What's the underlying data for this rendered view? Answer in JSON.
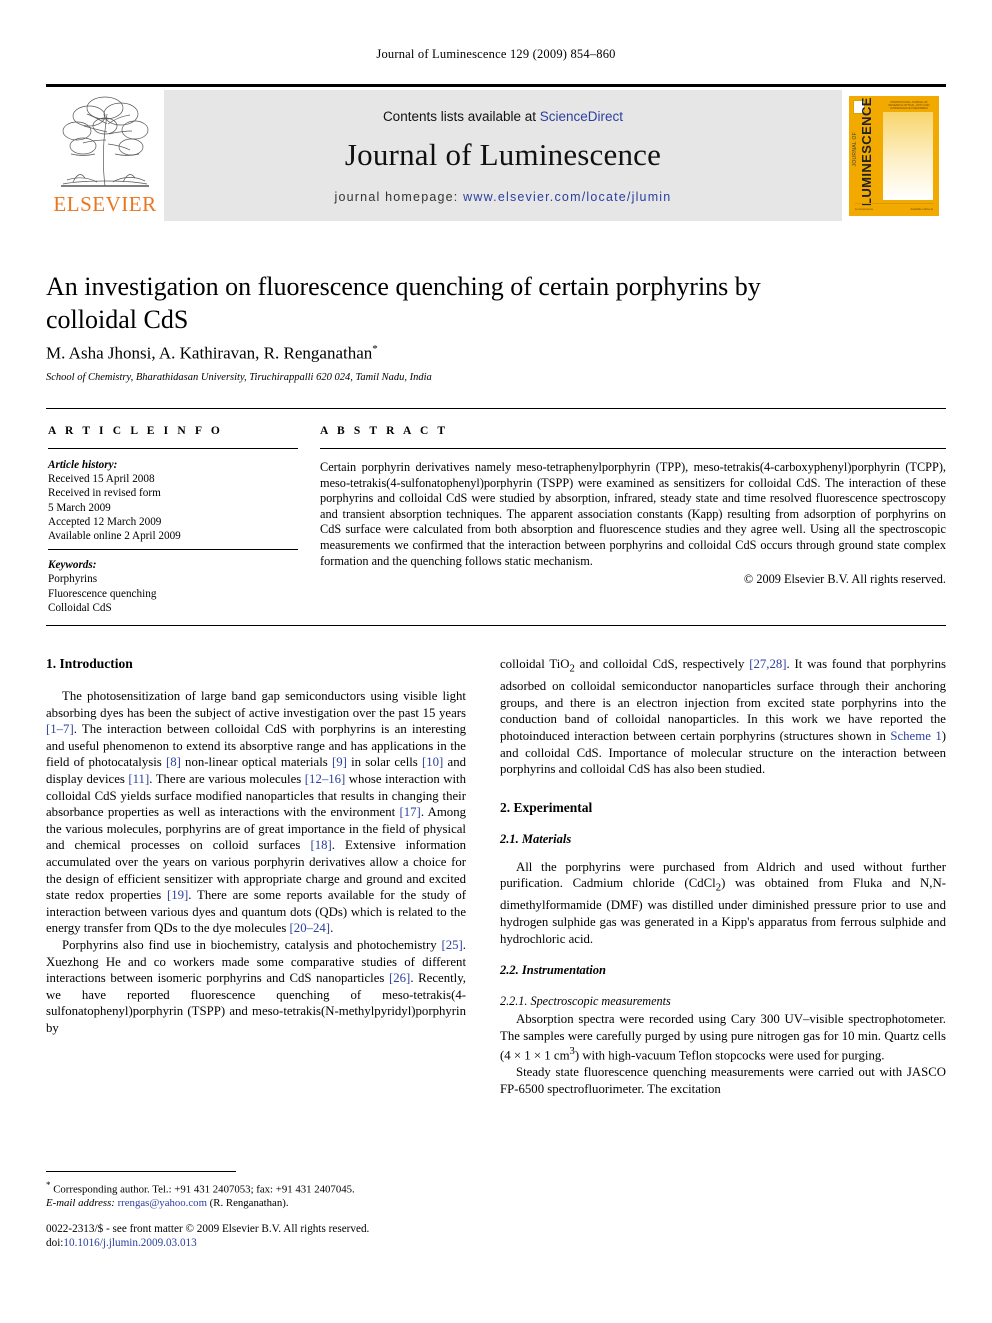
{
  "running_head": "Journal of Luminescence 129 (2009) 854–860",
  "masthead": {
    "elsevier_wordmark": "ELSEVIER",
    "contents_prefix": "Contents lists available at ",
    "sciencedirect": "ScienceDirect",
    "journal_title": "Journal of Luminescence",
    "homepage_prefix": "journal homepage: ",
    "homepage_url": "www.elsevier.com/locate/jlumin",
    "cover": {
      "vertical_main": "LUMINESCENCE",
      "vertical_small": "JOURNAL OF",
      "top_caption": "INTERNATIONAL JOURNAL OF RESEARCH OPTICAL, OPTO AND LUMINESCENCE PHENOMENA",
      "bottom_left": "Luminescence",
      "bottom_right": "Available online at"
    },
    "accent_orange": "#E87722",
    "cover_yellow": "#F2A900",
    "link_blue": "#2b3f9e",
    "banner_gray": "#e6e6e6"
  },
  "article": {
    "title": "An investigation on fluorescence quenching of certain porphyrins by colloidal CdS",
    "authors": "M. Asha Jhonsi, A. Kathiravan, R. Renganathan",
    "author_marker": "*",
    "affiliation": "School of Chemistry, Bharathidasan University, Tiruchirappalli 620 024, Tamil Nadu, India"
  },
  "article_info": {
    "heading": "A R T I C L E   I N F O",
    "history_label": "Article history:",
    "history": [
      "Received 15 April 2008",
      "Received in revised form",
      "5 March 2009",
      "Accepted 12 March 2009",
      "Available online 2 April 2009"
    ],
    "keywords_label": "Keywords:",
    "keywords": [
      "Porphyrins",
      "Fluorescence quenching",
      "Colloidal CdS"
    ]
  },
  "abstract": {
    "heading": "A B S T R A C T",
    "text": "Certain porphyrin derivatives namely meso-tetraphenylporphyrin (TPP), meso-tetrakis(4-carboxyphenyl)porphyrin (TCPP), meso-tetrakis(4-sulfonatophenyl)porphyrin (TSPP) were examined as sensitizers for colloidal CdS. The interaction of these porphyrins and colloidal CdS were studied by absorption, infrared, steady state and time resolved fluorescence spectroscopy and transient absorption techniques. The apparent association constants (Kapp) resulting from adsorption of porphyrins on CdS surface were calculated from both absorption and fluorescence studies and they agree well. Using all the spectroscopic measurements we confirmed that the interaction between porphyrins and colloidal CdS occurs through ground state complex formation and the quenching follows static mechanism.",
    "copyright": "© 2009 Elsevier B.V. All rights reserved."
  },
  "body": {
    "intro_heading": "1.  Introduction",
    "intro_p1_a": "The photosensitization of large band gap semiconductors using visible light absorbing dyes has been the subject of active investigation over the past 15 years ",
    "intro_p1_r1": "[1–7]",
    "intro_p1_b": ". The interaction between colloidal CdS with porphyrins is an interesting and useful phenomenon to extend its absorptive range and has applications in the field of photocatalysis ",
    "intro_p1_r2": "[8]",
    "intro_p1_c": " non-linear optical materials ",
    "intro_p1_r3": "[9]",
    "intro_p1_d": " in solar cells ",
    "intro_p1_r4": "[10]",
    "intro_p1_e": " and display devices ",
    "intro_p1_r5": "[11]",
    "intro_p1_f": ". There are various molecules ",
    "intro_p1_r6": "[12–16]",
    "intro_p1_g": " whose interaction with colloidal CdS yields surface modified nanoparticles that results in changing their absorbance properties as well as interactions with the environment ",
    "intro_p1_r7": "[17]",
    "intro_p1_h": ". Among the various molecules, porphyrins are of great importance in the field of physical and chemical processes on colloid surfaces ",
    "intro_p1_r8": "[18]",
    "intro_p1_i": ". Extensive information accumulated over the years on various porphyrin derivatives allow a choice for the design of efficient sensitizer with appropriate charge and ground and excited state redox properties ",
    "intro_p1_r9": "[19]",
    "intro_p1_j": ". There are some reports available for the study of interaction between various dyes and quantum dots (QDs) which is related to the energy transfer from QDs to the dye molecules ",
    "intro_p1_r10": "[20–24]",
    "intro_p1_k": ".",
    "intro_p2_a": "Porphyrins also find use in biochemistry, catalysis and photochemistry ",
    "intro_p2_r1": "[25]",
    "intro_p2_b": ". Xuezhong He and co workers made some comparative studies of different interactions between isomeric porphyrins and CdS nanoparticles ",
    "intro_p2_r2": "[26]",
    "intro_p2_c": ". Recently, we have reported fluorescence quenching of meso-tetrakis(4-sulfonatophenyl)porphyrin (TSPP) and meso-tetrakis(N-methylpyridyl)porphyrin by",
    "right_p1_a": "colloidal TiO",
    "right_p1_sub": "2",
    "right_p1_b": " and colloidal CdS, respectively ",
    "right_p1_r1": "[27,28]",
    "right_p1_c": ". It was found that porphyrins adsorbed on colloidal semiconductor nanoparticles surface through their anchoring groups, and there is an electron injection from excited state porphyrins into the conduction band of colloidal nanoparticles. In this work we have reported the photoinduced interaction between certain porphyrins (structures shown in ",
    "right_p1_link": "Scheme 1",
    "right_p1_d": ") and colloidal CdS. Importance of molecular structure on the interaction between porphyrins and colloidal CdS has also been studied.",
    "exp_heading": "2.  Experimental",
    "materials_heading": "2.1.  Materials",
    "materials_a": "All the porphyrins were purchased from Aldrich and used without further purification. Cadmium chloride (CdCl",
    "materials_sub1": "2",
    "materials_b": ") was obtained from Fluka and N,N-dimethylformamide (DMF) was distilled under diminished pressure prior to use and hydrogen sulphide gas was generated in a Kipp's apparatus from ferrous sulphide and hydrochloric acid.",
    "instr_heading": "2.2.  Instrumentation",
    "spectro_heading": "2.2.1.  Spectroscopic measurements",
    "spectro_a": "Absorption spectra were recorded using Cary 300 UV–visible spectrophotometer. The samples were carefully purged by using pure nitrogen gas for 10 min. Quartz cells (4 × 1 × 1 cm",
    "spectro_sup": "3",
    "spectro_b": ") with high-vacuum Teflon stopcocks were used for purging.",
    "steady_a": "Steady state fluorescence quenching measurements were carried out with JASCO FP-6500 spectrofluorimeter. The excitation"
  },
  "footnote": {
    "marker": "*",
    "corresponding": " Corresponding author. Tel.: +91 431 2407053; fax: +91 431 2407045.",
    "email_label": "E-mail address:",
    "email": "rrengas@yahoo.com",
    "email_attrib": " (R. Renganathan)."
  },
  "imprint": {
    "line1": "0022-2313/$ - see front matter © 2009 Elsevier B.V. All rights reserved.",
    "doi_label": "doi:",
    "doi": "10.1016/j.jlumin.2009.03.013"
  }
}
